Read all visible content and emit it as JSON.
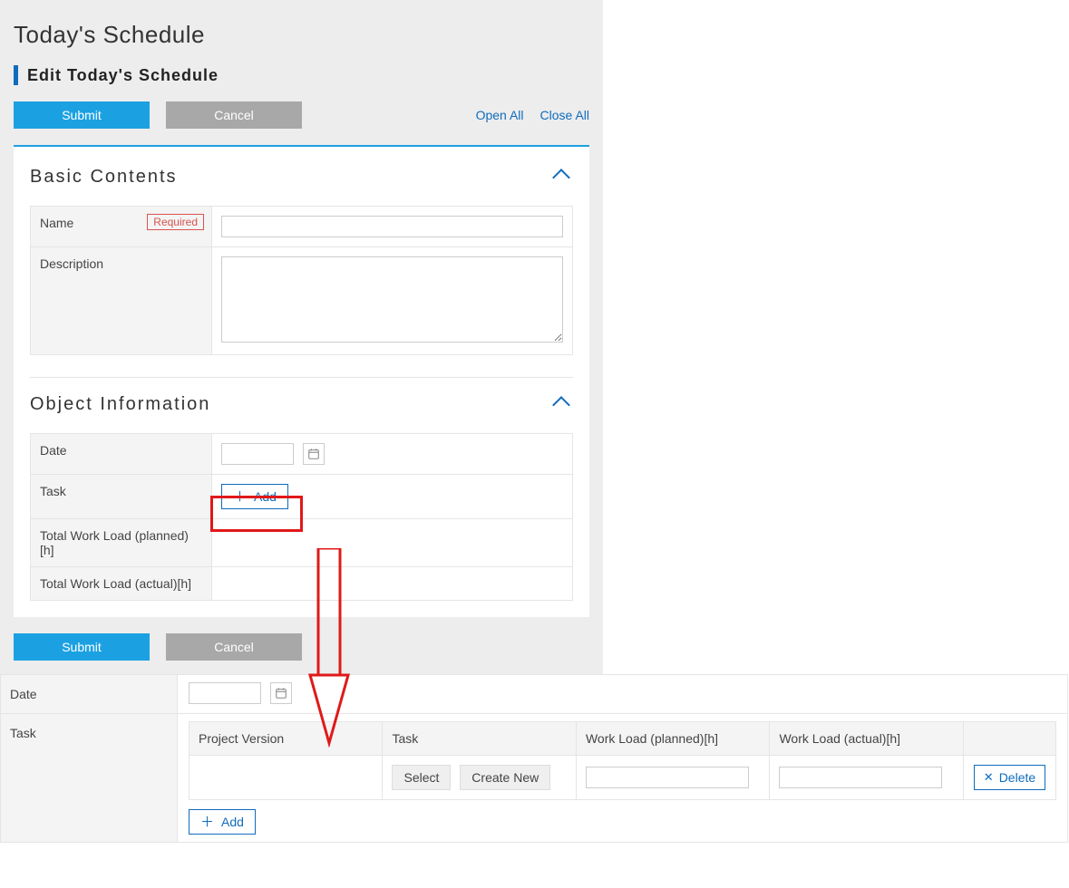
{
  "page_title": "Today's Schedule",
  "subtitle": "Edit Today's Schedule",
  "actions": {
    "submit": "Submit",
    "cancel": "Cancel",
    "open_all": "Open All",
    "close_all": "Close All"
  },
  "sections": {
    "basic": {
      "title": "Basic Contents",
      "fields": {
        "name_label": "Name",
        "name_required": "Required",
        "description_label": "Description"
      }
    },
    "object_info": {
      "title": "Object Information",
      "fields": {
        "date_label": "Date",
        "task_label": "Task",
        "add_label": "Add",
        "total_planned_label": "Total Work Load (planned)[h]",
        "total_actual_label": "Total Work Load (actual)[h]"
      }
    }
  },
  "detail": {
    "date_label": "Date",
    "task_label": "Task",
    "table_headers": {
      "project_version": "Project Version",
      "task": "Task",
      "work_planned": "Work Load (planned)[h]",
      "work_actual": "Work Load (actual)[h]"
    },
    "row_actions": {
      "select": "Select",
      "create_new": "Create New",
      "delete": "Delete",
      "add": "Add"
    }
  }
}
